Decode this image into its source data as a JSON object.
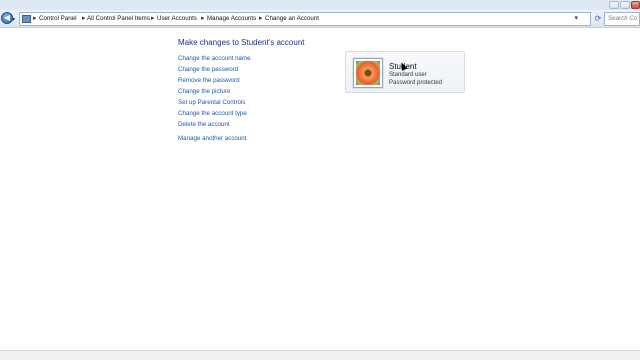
{
  "address": {
    "crumbs": [
      "Control Panel",
      "All Control Panel Items",
      "User Accounts",
      "Manage Accounts",
      "Change an Account"
    ],
    "search_placeholder": "Search Co"
  },
  "main": {
    "title": "Make changes to Student's account",
    "tasks": [
      "Change the account name",
      "Change the password",
      "Remove the password",
      "Change the picture",
      "Set up Parental Controls",
      "Change the account type",
      "Delete the account"
    ],
    "other_link": "Manage another account"
  },
  "account": {
    "name": "Student",
    "type": "Standard user",
    "status": "Password protected"
  },
  "icons": [
    "back-icon",
    "forward-icon",
    "control-panel-icon",
    "refresh-icon",
    "minimize-icon",
    "maximize-icon",
    "close-icon",
    "flower-account-picture"
  ],
  "colors": {
    "link": "#1e5aa8",
    "title": "#1e3287"
  }
}
